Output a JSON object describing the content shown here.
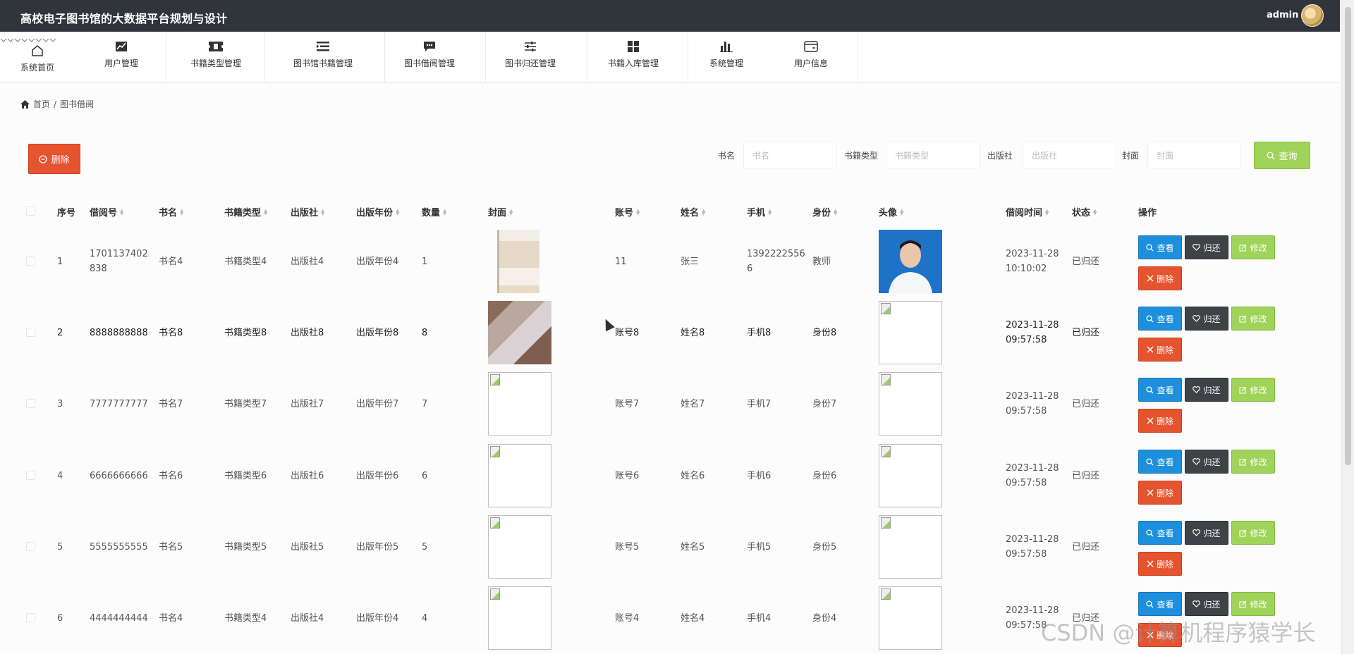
{
  "header": {
    "title": "高校电子图书馆的大数据平台规划与设计",
    "user": "admin"
  },
  "nav": [
    {
      "label": "系统首页",
      "icon": "home-icon"
    },
    {
      "label": "用户管理",
      "icon": "chart-line-icon"
    },
    {
      "label": "书籍类型管理",
      "icon": "ticket-icon"
    },
    {
      "label": "图书馆书籍管理",
      "icon": "list-icon"
    },
    {
      "label": "图书借阅管理",
      "icon": "comment-icon"
    },
    {
      "label": "图书归还管理",
      "icon": "sliders-icon"
    },
    {
      "label": "书籍入库管理",
      "icon": "grid-icon"
    },
    {
      "label": "系统管理",
      "icon": "bar-chart-icon"
    },
    {
      "label": "用户信息",
      "icon": "card-icon"
    }
  ],
  "breadcrumb": {
    "home": "首页",
    "sep": "/",
    "current": "图书借阅"
  },
  "toolbar": {
    "delete_label": "删除",
    "filters": [
      {
        "label": "书名",
        "placeholder": "书名"
      },
      {
        "label": "书籍类型",
        "placeholder": "书籍类型"
      },
      {
        "label": "出版社",
        "placeholder": "出版社"
      },
      {
        "label": "封面",
        "placeholder": "封面"
      }
    ],
    "query_label": "查询"
  },
  "table": {
    "columns": [
      "序号",
      "借阅号",
      "书名",
      "书籍类型",
      "出版社",
      "出版年份",
      "数量",
      "封面",
      "账号",
      "姓名",
      "手机",
      "身份",
      "头像",
      "借阅时间",
      "状态",
      "操作"
    ],
    "actions": {
      "view": "查看",
      "return": "归还",
      "edit": "修改",
      "delete": "删除"
    },
    "rows": [
      {
        "no": "1",
        "borrow_no": [
          "1701137402",
          "838"
        ],
        "book": "书名4",
        "type": "书籍类型4",
        "publisher": "出版社4",
        "year": "出版年份4",
        "qty": "1",
        "account": "11",
        "name": "张三",
        "phone": [
          "1392222556",
          "6"
        ],
        "role": "教师",
        "time": [
          "2023-11-28",
          "10:10:02"
        ],
        "status": "已归还"
      },
      {
        "no": "2",
        "borrow_no": [
          "8888888888"
        ],
        "book": "书名8",
        "type": "书籍类型8",
        "publisher": "出版社8",
        "year": "出版年份8",
        "qty": "8",
        "account": "账号8",
        "name": "姓名8",
        "phone": [
          "手机8"
        ],
        "role": "身份8",
        "time": [
          "2023-11-28",
          "09:57:58"
        ],
        "status": "已归还"
      },
      {
        "no": "3",
        "borrow_no": [
          "7777777777"
        ],
        "book": "书名7",
        "type": "书籍类型7",
        "publisher": "出版社7",
        "year": "出版年份7",
        "qty": "7",
        "account": "账号7",
        "name": "姓名7",
        "phone": [
          "手机7"
        ],
        "role": "身份7",
        "time": [
          "2023-11-28",
          "09:57:58"
        ],
        "status": "已归还"
      },
      {
        "no": "4",
        "borrow_no": [
          "6666666666"
        ],
        "book": "书名6",
        "type": "书籍类型6",
        "publisher": "出版社6",
        "year": "出版年份6",
        "qty": "6",
        "account": "账号6",
        "name": "姓名6",
        "phone": [
          "手机6"
        ],
        "role": "身份6",
        "time": [
          "2023-11-28",
          "09:57:58"
        ],
        "status": "已归还"
      },
      {
        "no": "5",
        "borrow_no": [
          "5555555555"
        ],
        "book": "书名5",
        "type": "书籍类型5",
        "publisher": "出版社5",
        "year": "出版年份5",
        "qty": "5",
        "account": "账号5",
        "name": "姓名5",
        "phone": [
          "手机5"
        ],
        "role": "身份5",
        "time": [
          "2023-11-28",
          "09:57:58"
        ],
        "status": "已归还"
      },
      {
        "no": "6",
        "borrow_no": [
          "4444444444"
        ],
        "book": "书名4",
        "type": "书籍类型4",
        "publisher": "出版社4",
        "year": "出版年份4",
        "qty": "4",
        "account": "账号4",
        "name": "姓名4",
        "phone": [
          "手机4"
        ],
        "role": "身份4",
        "time": [
          "2023-11-28",
          "09:57:58"
        ],
        "status": "已归还"
      }
    ]
  },
  "watermark": "CSDN @计算机程序猿学长",
  "colors": {
    "header_bg": "#30343b",
    "danger": "#e6532f",
    "primary": "#1e8fdc",
    "success": "#9fd35a",
    "dark": "#3f4246"
  }
}
